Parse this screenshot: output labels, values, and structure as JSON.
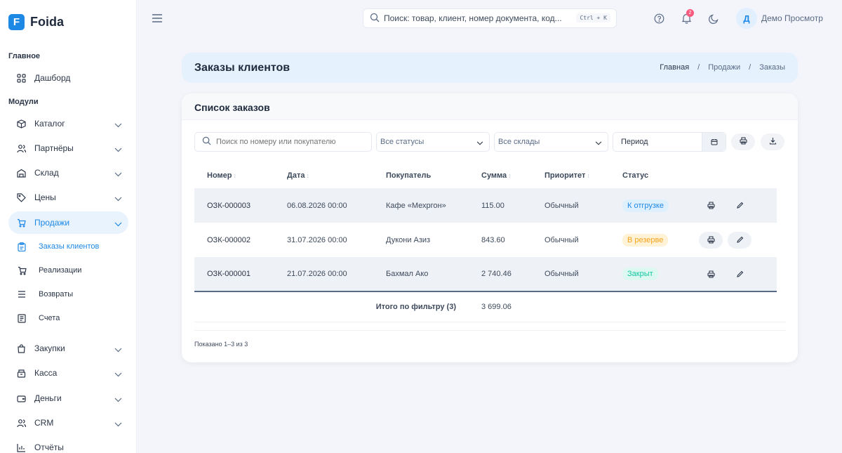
{
  "brand": {
    "name": "Foida",
    "logo_letter": "F"
  },
  "sidebar": {
    "section_main": "Главное",
    "section_modules": "Модули",
    "dashboard": "Дашборд",
    "items": [
      {
        "label": "Каталог",
        "icon": "box-icon"
      },
      {
        "label": "Партнёры",
        "icon": "users-icon"
      },
      {
        "label": "Склад",
        "icon": "warehouse-icon"
      },
      {
        "label": "Цены",
        "icon": "tag-icon"
      },
      {
        "label": "Продажи",
        "icon": "cart-icon",
        "active": true
      }
    ],
    "sales_sub": [
      {
        "label": "Заказы клиентов",
        "icon": "clipboard-icon",
        "active": true
      },
      {
        "label": "Реализации",
        "icon": "cart-icon"
      },
      {
        "label": "Возвраты",
        "icon": "list-icon"
      },
      {
        "label": "Счета",
        "icon": "receipt-icon"
      }
    ],
    "items_after": [
      {
        "label": "Закупки",
        "icon": "bag-icon"
      },
      {
        "label": "Касса",
        "icon": "register-icon"
      },
      {
        "label": "Деньги",
        "icon": "wallet-icon"
      },
      {
        "label": "CRM",
        "icon": "users-icon"
      },
      {
        "label": "Отчёты",
        "icon": "chart-icon"
      }
    ]
  },
  "topbar": {
    "search_placeholder": "Поиск: товар, клиент, номер документа, код...",
    "shortcut": "Ctrl + K",
    "notif_count": "2",
    "avatar_letter": "Д",
    "user_name": "Демо Просмотр"
  },
  "header": {
    "title": "Заказы клиентов",
    "breadcrumb": [
      "Главная",
      "/",
      "Продажи",
      "/",
      "Заказы"
    ]
  },
  "card": {
    "title": "Список заказов",
    "search_placeholder": "Поиск по номеру или покупателю",
    "status_filter": "Все статусы",
    "warehouse_filter": "Все склады",
    "period_placeholder": "Период"
  },
  "table": {
    "columns": [
      "Номер",
      "Дата",
      "Покупатель",
      "Сумма",
      "Приоритет",
      "Статус"
    ],
    "rows": [
      {
        "number": "ОЗК-000003",
        "date": "06.08.2026 00:00",
        "buyer": "Кафе «Мехргон»",
        "sum": "115.00",
        "priority": "Обычный",
        "status": "К отгрузке",
        "status_color": "#1e88e5",
        "status_bg": "#dff0fd"
      },
      {
        "number": "ОЗК-000002",
        "date": "31.07.2026 00:00",
        "buyer": "Дукони Азиз",
        "sum": "843.60",
        "priority": "Обычный",
        "status": "В резерве",
        "status_color": "#f4a41d",
        "status_bg": "#fff2d6"
      },
      {
        "number": "ОЗК-000001",
        "date": "21.07.2026 00:00",
        "buyer": "Бахмал Ако",
        "sum": "2 740.46",
        "priority": "Обычный",
        "status": "Закрыт",
        "status_color": "#13c7a2",
        "status_bg": "#ddf8f1"
      }
    ],
    "total_label": "Итого по фильтру (3)",
    "total_sum": "3 699.06"
  },
  "footer": {
    "shown": "Показано 1–3 из 3"
  }
}
